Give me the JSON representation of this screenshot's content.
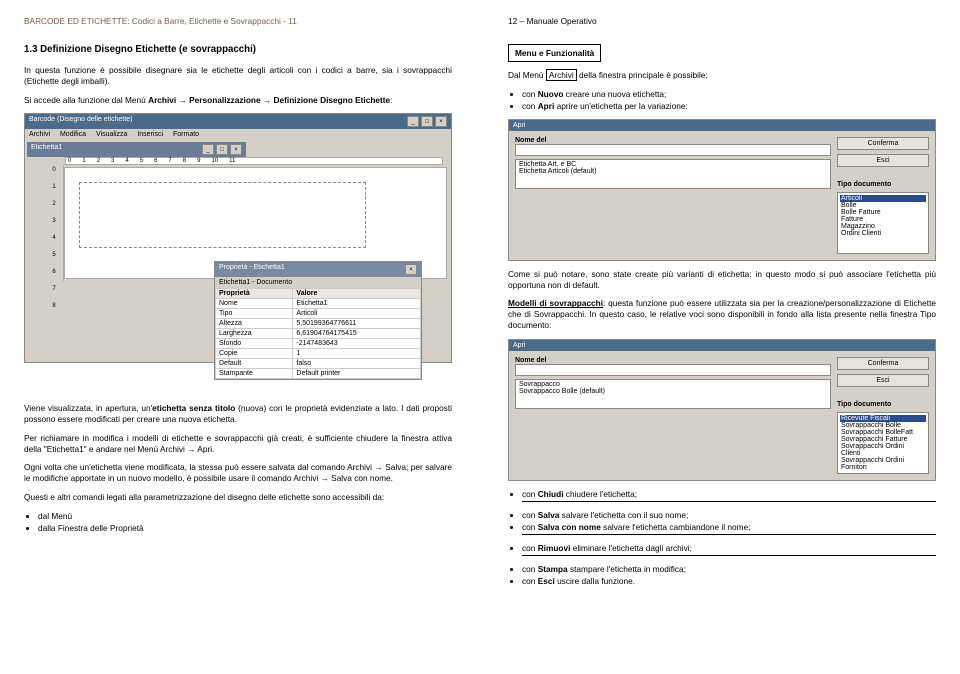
{
  "left": {
    "header": "BARCODE ED ETICHETTE: Codici a Barre, Etichette e Sovrappacchi - 11",
    "h1": "1.3 Definizione Disegno Etichette (e sovrappacchi)",
    "p1": "In questa funzione è possibile disegnare sia le etichette degli articoli con i codici a barre, sia i sovrappacchi (Etichette degli imballi).",
    "p2a": "Si accede alla funzione dal Menù ",
    "p2b": "Archivi",
    "p2c": " → ",
    "p2d": "Personalizzazione",
    "p2e": " → ",
    "p2f": "Definizione Disegno Etichette",
    "p2g": ":",
    "scr1": {
      "title": "Barcode (Disegno delle etichette)",
      "menu": [
        "Archivi",
        "Modifica",
        "Visualizza",
        "Inserisci",
        "Formato"
      ],
      "ruler_h": [
        "0",
        "1",
        "2",
        "3",
        "4",
        "5",
        "6",
        "7",
        "8",
        "9",
        "10",
        "11"
      ],
      "ruler_v": [
        "0",
        "1",
        "2",
        "3",
        "4",
        "5",
        "6",
        "7",
        "8"
      ],
      "inner_title": "Etichetta1",
      "prop": {
        "title": "Proprietà - Etichetta1",
        "sub": "Etichetta1 - Documento",
        "cols": [
          "Proprietà",
          "Valore"
        ],
        "rows": [
          [
            "Nome",
            "Etichetta1"
          ],
          [
            "Tipo",
            "Articoli"
          ],
          [
            "Altezza",
            "5,50199364776611"
          ],
          [
            "Larghezza",
            "6,61904764175415"
          ],
          [
            "Sfondo",
            "-2147483643"
          ],
          [
            "Copie",
            "1"
          ],
          [
            "Default",
            "falso"
          ],
          [
            "Stampante",
            "Default printer"
          ]
        ]
      }
    },
    "p3a": "Viene visualizzata, in apertura, un'",
    "p3b": "etichetta senza titolo",
    "p3c": " (nuova) con le proprietà evidenziate a lato. I dati proposti possono essere modificati per creare una nuova etichetta.",
    "p4": "Per richiamare in modifica i modelli di etichette e sovrappacchi già creati, è sufficiente chiudere la finestra attiva della \"Etichetta1\" e andare nel Menù Archivi → Apri.",
    "p5": "Ogni volta che un'etichetta viene modificata, la stessa può essere salvata dal comando Archivi → Salva; per salvare le modifiche apportate in un nuovo modello, è possibile usare il comando Archivi → Salva con nome.",
    "p6": "Questi e altri comandi legati alla parametrizzazione del disegno delle etichette sono accessibili da:",
    "li1": "dal Menù",
    "li2": "dalla Finestra delle Proprietà"
  },
  "right": {
    "header": "12 – Manuale Operativo",
    "box": "Menu e Funzionalità",
    "p1a": "Dal Menù ",
    "p1b": "Archivi",
    "p1c": " della finestra principale è possibile:",
    "li_nuovo_a": "con ",
    "li_nuovo_b": "Nuovo",
    "li_nuovo_c": " creare una nuova etichetta;",
    "li_apri_a": "con ",
    "li_apri_b": "Apri",
    "li_apri_c": " aprire un'etichetta per la variazione:",
    "apri1": {
      "title": "Apri",
      "nome_label": "Nome del",
      "list": [
        "Etichetta Art. e BC",
        "Etichetta Articoli        (default)"
      ],
      "btn1": "Conferma",
      "btn2": "Esci",
      "tipo_label": "Tipo documento",
      "tipo": [
        "Articoli",
        "Bolle",
        "Bolle Fatture",
        "Fatture",
        "Magazzino",
        "Ordini Clienti"
      ]
    },
    "p2": "Come si può notare, sono state create più varianti di etichetta: in questo modo si può associare l'etichetta più opportuna non di default.",
    "p3a": "Modelli di sovrappacchi",
    "p3b": ": questa funzione può essere utilizzata sia per la creazione/personalizzazione di Etichette che di Sovrappacchi. In questo caso, le relative voci sono disponibili in fondo alla lista presente nella finestra Tipo documento:",
    "apri2": {
      "title": "Apri",
      "nome_label": "Nome del",
      "list": [
        "Sovrappacco",
        "Sovrappacco Bolle        (default)"
      ],
      "btn1": "Conferma",
      "btn2": "Esci",
      "tipo_label": "Tipo documento",
      "tipo": [
        "Ricevute Fiscali",
        "Sovrappacchi Bolle",
        "Sovrappacchi BolleFatt",
        "Sovrappacchi Fatture",
        "Sovrappacchi Ordini Clienti",
        "Sovrappacchi Ordini Fornitori"
      ],
      "sel_index": 0
    },
    "li_chiudi_a": "con ",
    "li_chiudi_b": "Chiudi",
    "li_chiudi_c": " chiudere l'etichetta;",
    "li_salva_a": "con ",
    "li_salva_b": "Salva",
    "li_salva_c": " salvare l'etichetta con il suo nome;",
    "li_salvan_a": "con ",
    "li_salvan_b": "Salva con nome",
    "li_salvan_c": " salvare l'etichetta cambiandone il nome;",
    "li_rimuovi_a": "con ",
    "li_rimuovi_b": "Rimuovi",
    "li_rimuovi_c": " eliminare l'etichetta dagli archivi;",
    "li_stampa_a": "con ",
    "li_stampa_b": "Stampa",
    "li_stampa_c": " stampare l'etichetta in modifica;",
    "li_esci_a": "con ",
    "li_esci_b": "Esci",
    "li_esci_c": " uscire dalla funzione."
  }
}
